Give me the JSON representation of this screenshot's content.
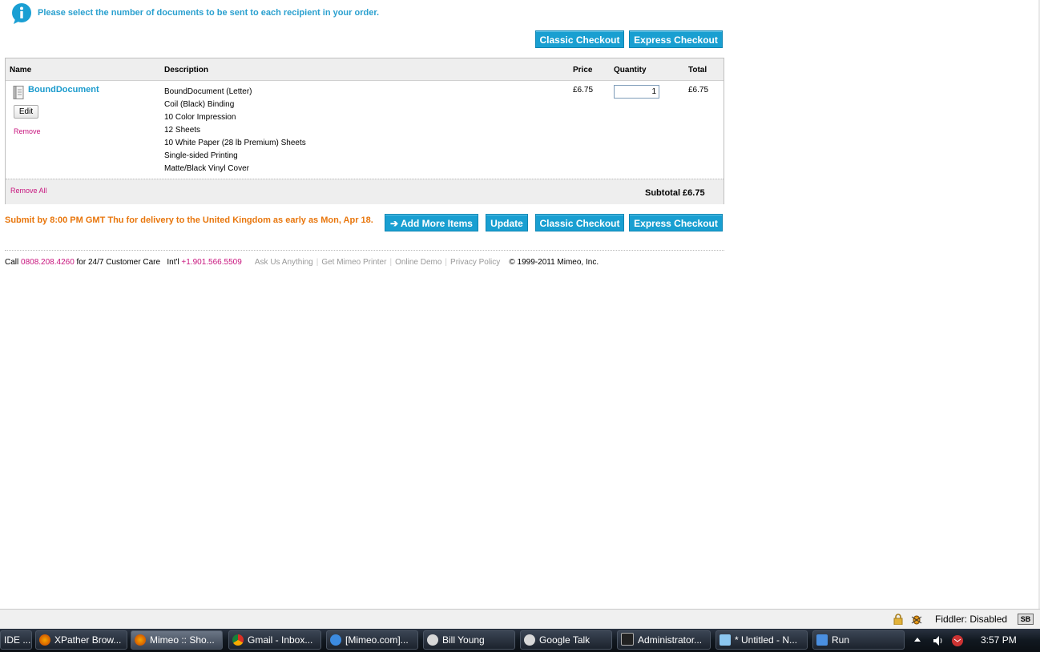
{
  "info": {
    "message": "Please select the number of documents to be sent to each recipient in your order."
  },
  "buttons": {
    "classic_checkout": "Classic Checkout",
    "express_checkout": "Express Checkout",
    "add_more_items": "➔ Add More Items",
    "update": "Update"
  },
  "cart": {
    "headers": {
      "name": "Name",
      "description": "Description",
      "price": "Price",
      "quantity": "Quantity",
      "total": "Total"
    },
    "item": {
      "name": "BoundDocument",
      "edit": "Edit",
      "remove": "Remove",
      "description": [
        "BoundDocument (Letter)",
        "Coil (Black) Binding",
        "10 Color Impression",
        "12 Sheets",
        "10 White Paper (28 lb Premium) Sheets",
        "Single-sided Printing",
        "Matte/Black Vinyl Cover"
      ],
      "price": "£6.75",
      "quantity": "1",
      "total": "£6.75"
    },
    "remove_all": "Remove All",
    "subtotal": "Subtotal £6.75"
  },
  "delivery_message": "Submit by 8:00 PM GMT Thu for delivery to the United Kingdom as early as Mon, Apr 18.",
  "footer": {
    "call": "Call",
    "phone": "0808.208.4260",
    "care": "for 24/7 Customer Care",
    "intl": "Int'l",
    "intl_phone": "+1.901.566.5509",
    "links": [
      "Ask Us Anything",
      "Get Mimeo Printer",
      "Online Demo",
      "Privacy Policy"
    ],
    "copyright": "© 1999-2011 Mimeo, Inc."
  },
  "statusbar": {
    "fiddler": "Fiddler: Disabled",
    "sb": "SB"
  },
  "taskbar": {
    "items": [
      {
        "label": "IDE ...",
        "icon": "ide-icon"
      },
      {
        "label": "XPather Brow...",
        "icon": "firefox-icon"
      },
      {
        "label": "Mimeo :: Sho...",
        "icon": "firefox-icon"
      },
      {
        "label": "Gmail - Inbox...",
        "icon": "chrome-icon"
      },
      {
        "label": "[Mimeo.com]...",
        "icon": "ie-icon"
      },
      {
        "label": "Bill Young",
        "icon": "chat-icon"
      },
      {
        "label": "Google Talk",
        "icon": "chat-icon"
      },
      {
        "label": "Administrator...",
        "icon": "cmd-icon"
      },
      {
        "label": "* Untitled - N...",
        "icon": "notepad-icon"
      },
      {
        "label": "Run",
        "icon": "run-icon"
      }
    ],
    "clock": "3:57 PM"
  },
  "colors": {
    "accent_blue": "#199fd1",
    "link_pink": "#c8157e",
    "warning_orange": "#e8760c"
  }
}
